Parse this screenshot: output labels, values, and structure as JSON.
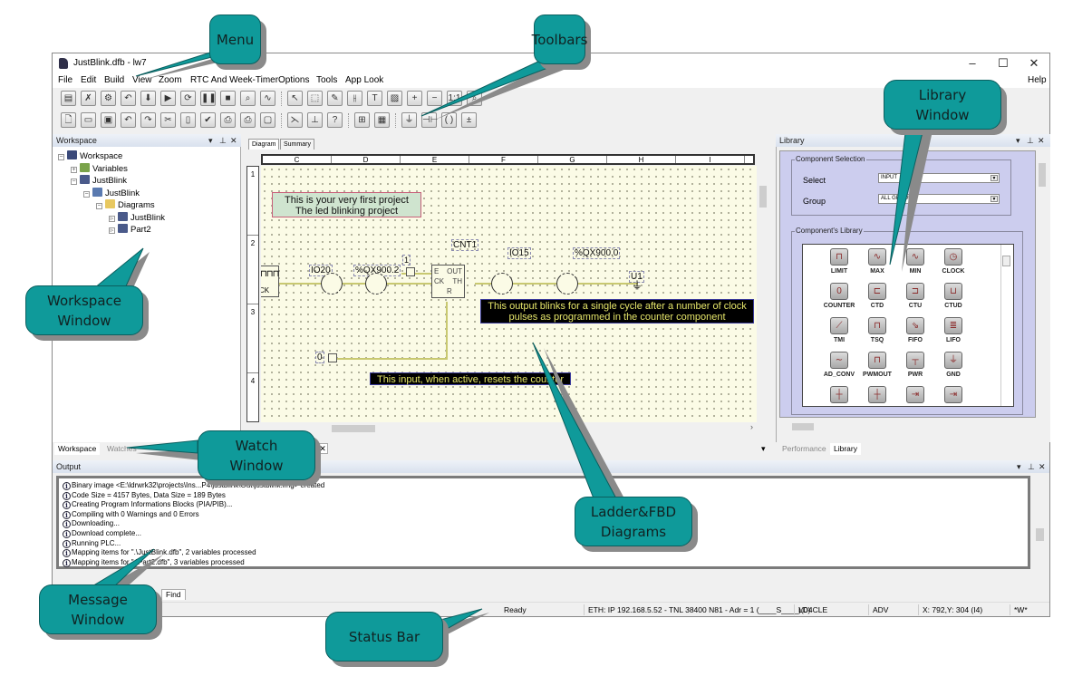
{
  "window": {
    "title": "JustBlink.dfb - lw7",
    "controls": {
      "minimize": "–",
      "maximize": "☐",
      "close": "✕"
    }
  },
  "menu": [
    "File",
    "Edit",
    "Build",
    "View",
    "Zoom",
    "RTC And Week-Timer",
    "Options",
    "Tools",
    "App Look"
  ],
  "menu_help": "Help",
  "toolbar1": [
    {
      "name": "compile-icon",
      "glyph": "▤"
    },
    {
      "name": "clean-icon",
      "glyph": "✗"
    },
    {
      "name": "build-all-icon",
      "glyph": "⚙"
    },
    {
      "name": "undo-arrow-icon",
      "glyph": "↶"
    },
    {
      "name": "download-icon",
      "glyph": "⬇"
    },
    {
      "name": "run-icon",
      "glyph": "▶"
    },
    {
      "name": "refresh-icon",
      "glyph": "⟳"
    },
    {
      "name": "pause-icon",
      "glyph": "❚❚"
    },
    {
      "name": "stop-icon",
      "glyph": "■"
    },
    {
      "name": "monitor-icon",
      "glyph": "⌕"
    },
    {
      "name": "scope-icon",
      "glyph": "∿"
    },
    {
      "name": "select-icon",
      "glyph": "↖"
    },
    {
      "name": "rect-select-icon",
      "glyph": "⬚"
    },
    {
      "name": "eraser-icon",
      "glyph": "✎"
    },
    {
      "name": "contact-icon",
      "glyph": "⫲"
    },
    {
      "name": "text-icon",
      "glyph": "T"
    },
    {
      "name": "image-icon",
      "glyph": "▨"
    },
    {
      "name": "zoom-in-icon",
      "glyph": "+"
    },
    {
      "name": "zoom-out-icon",
      "glyph": "−"
    },
    {
      "name": "zoom-1to1-icon",
      "glyph": "1:1"
    },
    {
      "name": "zoom-fit-icon",
      "glyph": "⌕"
    }
  ],
  "toolbar2": [
    {
      "name": "new-file-icon",
      "glyph": "🗋"
    },
    {
      "name": "open-folder-icon",
      "glyph": "▭"
    },
    {
      "name": "save-icon",
      "glyph": "▣"
    },
    {
      "name": "undo-icon",
      "glyph": "↶"
    },
    {
      "name": "redo-icon",
      "glyph": "↷"
    },
    {
      "name": "cut-icon",
      "glyph": "✂"
    },
    {
      "name": "paste-icon",
      "glyph": "▯"
    },
    {
      "name": "check-icon",
      "glyph": "✔"
    },
    {
      "name": "print-preview-icon",
      "glyph": "⎙"
    },
    {
      "name": "print-icon",
      "glyph": "⎙"
    },
    {
      "name": "page-icon",
      "glyph": "▢"
    },
    {
      "name": "connect-icon",
      "glyph": "⋋"
    },
    {
      "name": "insert-row-icon",
      "glyph": "⊥"
    },
    {
      "name": "help-icon",
      "glyph": "?"
    },
    {
      "name": "grid-icon",
      "glyph": "⊞"
    },
    {
      "name": "table-icon",
      "glyph": "▦"
    },
    {
      "name": "ground-icon",
      "glyph": "⏚"
    },
    {
      "name": "capacitor-icon",
      "glyph": "⊣⊢"
    },
    {
      "name": "coil-icon",
      "glyph": "( )"
    },
    {
      "name": "power-icon",
      "glyph": "±"
    }
  ],
  "workspace": {
    "title": "Workspace",
    "tree": [
      {
        "label": "Workspace",
        "level": 0,
        "icon": "workspace-icon",
        "expander": "−"
      },
      {
        "label": "Variables",
        "level": 1,
        "icon": "variables-icon",
        "expander": "+"
      },
      {
        "label": "JustBlink",
        "level": 1,
        "icon": "project-icon",
        "expander": "−"
      },
      {
        "label": "JustBlink",
        "level": 2,
        "icon": "plc-icon",
        "expander": "−"
      },
      {
        "label": "Diagrams",
        "level": 3,
        "icon": "folder-icon",
        "expander": "−"
      },
      {
        "label": "JustBlink",
        "level": 4,
        "icon": "diagram-icon",
        "expander": "▹"
      },
      {
        "label": "Part2",
        "level": 4,
        "icon": "diagram-icon",
        "expander": "▹"
      }
    ],
    "bottom_tabs": [
      "Workspace",
      "Watches"
    ]
  },
  "editor": {
    "tabs": [
      "Diagram",
      "Summary"
    ],
    "columns": [
      "C",
      "D",
      "E",
      "F",
      "G",
      "H",
      "I"
    ],
    "rows": [
      "1",
      "2",
      "3",
      "4"
    ],
    "notes": {
      "intro_line1": "This is your very first project",
      "intro_line2": "The led blinking project",
      "output_line1": "This output blinks for a single cycle after a number of clock",
      "output_line2": "pulses as programmed in the counter component",
      "reset_note": "This input, when active, resets the counter"
    },
    "labels": {
      "clock_block": "CK",
      "io20": "IO20",
      "qx902": "%QX900.2",
      "const1": "1",
      "counter_name": "CNT1",
      "counter_e": "E",
      "counter_ck": "CK",
      "counter_out": "OUT",
      "counter_th": "TH",
      "counter_r": "R",
      "io15": "IO15",
      "qx900": "%QX900.0",
      "u1": "U1",
      "const0": "0"
    }
  },
  "library": {
    "title": "Library",
    "component_selection": "Component Selection",
    "select_label": "Select",
    "select_value": "INPUT",
    "group_label": "Group",
    "group_value": "ALL GROUPS",
    "components_title": "Component's Library",
    "components": [
      {
        "name": "LIMIT",
        "glyph": "⊓"
      },
      {
        "name": "MAX",
        "glyph": "∿"
      },
      {
        "name": "MIN",
        "glyph": "∿"
      },
      {
        "name": "CLOCK",
        "glyph": "◷"
      },
      {
        "name": "COUNTER",
        "glyph": "0"
      },
      {
        "name": "CTD",
        "glyph": "⊏"
      },
      {
        "name": "CTU",
        "glyph": "⊐"
      },
      {
        "name": "CTUD",
        "glyph": "⊔"
      },
      {
        "name": "TMI",
        "glyph": "⟋"
      },
      {
        "name": "TSQ",
        "glyph": "⊓"
      },
      {
        "name": "FIFO",
        "glyph": "⇘"
      },
      {
        "name": "LIFO",
        "glyph": "≣"
      },
      {
        "name": "AD_CONV",
        "glyph": "∼"
      },
      {
        "name": "PWMOUT",
        "glyph": "⊓"
      },
      {
        "name": "PWR",
        "glyph": "┬"
      },
      {
        "name": "GND",
        "glyph": "⏚"
      },
      {
        "name": "",
        "glyph": "┼"
      },
      {
        "name": "",
        "glyph": "┼"
      },
      {
        "name": "",
        "glyph": "⇥"
      },
      {
        "name": "",
        "glyph": "⇥"
      }
    ],
    "bottom_tabs": [
      "Performance",
      "Library"
    ]
  },
  "output": {
    "title": "Output",
    "lines": [
      "Binary image <E:\\ldrwrk32\\projects\\Ins...P4\\justblink\\Out\\justblink.img> created",
      "Code Size = 4157 Bytes, Data Size = 189 Bytes",
      "Creating Program Informations Blocks (PIA/PIB)...",
      "Compiling with 0 Warnings and 0 Errors",
      "Downloading...",
      "Download complete...",
      "Running PLC...",
      "Mapping items for \".\\JustBlink.dfb\", 2 variables processed",
      "Mapping items for \".\\Part2.dfb\", 3 variables processed"
    ],
    "tabs": [
      "Find"
    ]
  },
  "statusbar": {
    "ready": "Ready",
    "connection": "ETH: IP 192.168.5.52 - TNL 38400 N81 - Adr = 1 (____S____)(0)",
    "device": "LD4CLE",
    "mode": "ADV",
    "coords": "X: 792,Y: 304 (I4)",
    "flag": "*W*"
  },
  "callouts": {
    "menu": "Menu",
    "toolbars": "Toolbars",
    "library": "Library Window",
    "workspace": "Workspace Window",
    "watch": "Watch Window",
    "ladder": "Ladder&FBD Diagrams",
    "message": "Message Window",
    "status": "Status Bar"
  },
  "colors": {
    "callout": "#0f9a9a",
    "canvas": "#fbfbe6",
    "library_panel": "#cccdee",
    "note_black_text": "#e5e56a"
  }
}
